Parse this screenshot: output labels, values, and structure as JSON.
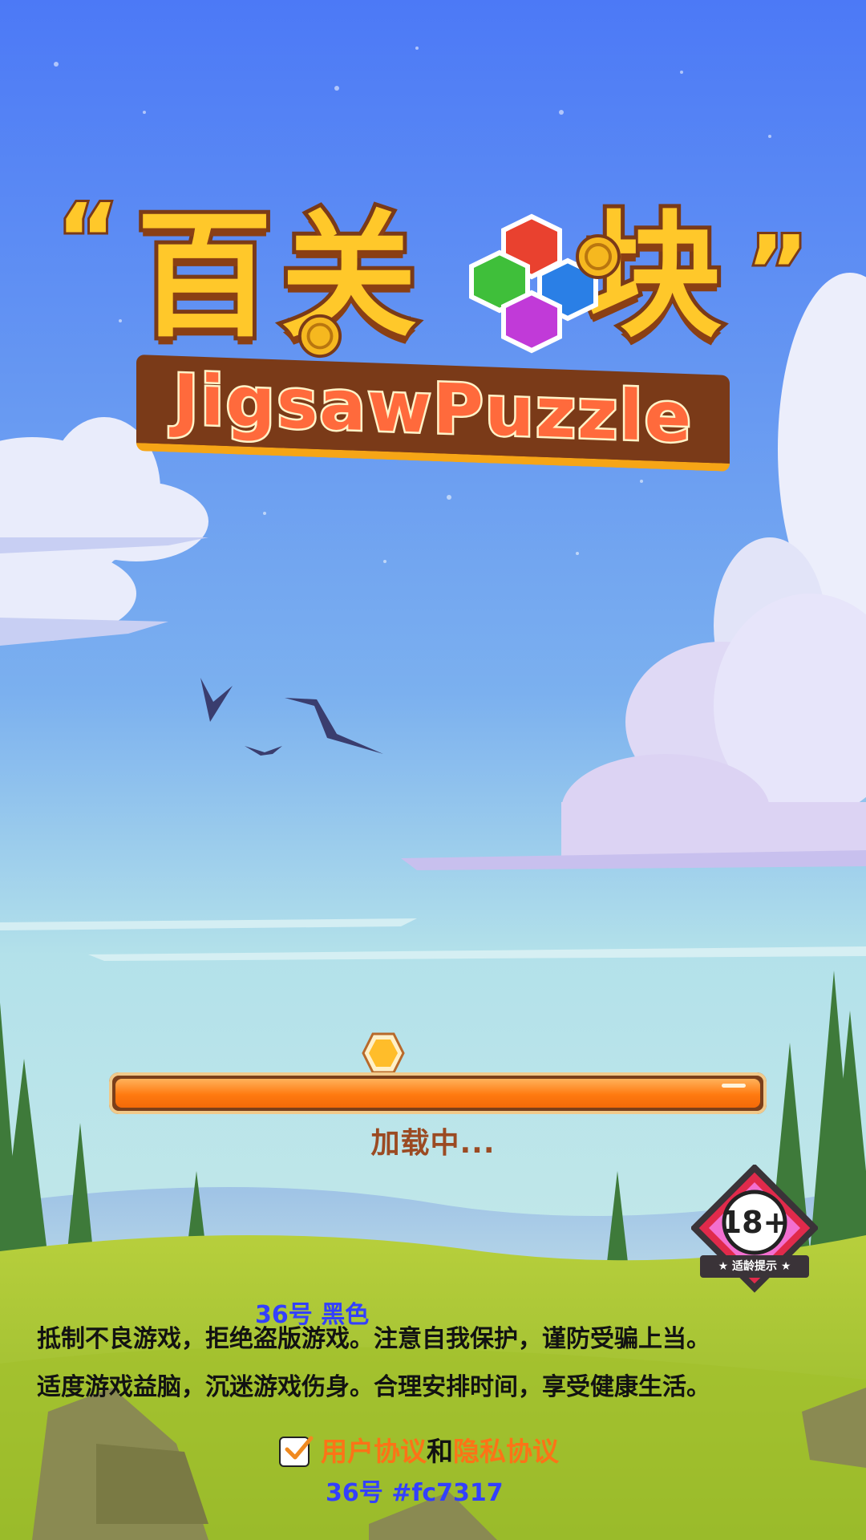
{
  "colors": {
    "sky_top": "#4c79f6",
    "sky_bottom": "#b3e1ea",
    "grass": "#a6c63a",
    "progress": "#ff7a10",
    "link": "#fc7317",
    "annotation": "#3340ff"
  },
  "logo": {
    "chinese_chars": [
      "百",
      "关",
      "块"
    ],
    "english_title": "JigsawPuzzle"
  },
  "loader": {
    "progress": 1.0,
    "text": "加载中..."
  },
  "age_rating": {
    "value": "18+",
    "label": "★ 适龄提示 ★"
  },
  "annotations": {
    "notice_spec": "36号  黑色",
    "agreement_spec": "36号  #fc7317"
  },
  "notice": {
    "line1": "抵制不良游戏，拒绝盗版游戏。注意自我保护，谨防受骗上当。",
    "line2": "适度游戏益脑，沉迷游戏伤身。合理安排时间，享受健康生活。"
  },
  "agreement": {
    "checked": true,
    "user_agreement": "用户协议",
    "conjunction": "和",
    "privacy_agreement": "隐私协议"
  }
}
